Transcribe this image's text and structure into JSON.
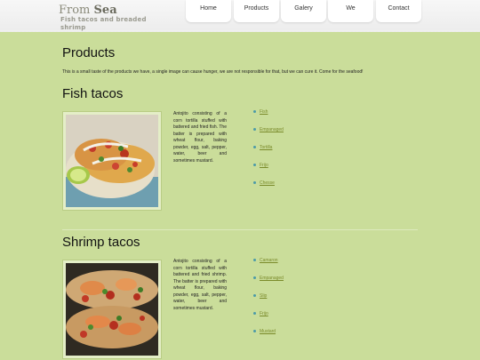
{
  "header": {
    "logo_prefix": "From",
    "logo_name": "Sea",
    "tagline": "Fish tacos and breaded shrimp"
  },
  "nav": [
    {
      "label": "Home"
    },
    {
      "label": "Products"
    },
    {
      "label": "Galery"
    },
    {
      "label": "We"
    },
    {
      "label": "Contact"
    }
  ],
  "page": {
    "title": "Products",
    "intro": "This is a small taste of the products we have, a single image can cause hunger, we are not responsible for that, but we can cure it. Come for the seafood!"
  },
  "products": [
    {
      "name": "Fish tacos",
      "description": "Antojito consisting of a corn tortilla stuffed with battered and fried fish. The batter is prepared with wheat flour, baking powder, egg, salt, pepper, water, beer and sometimes mustard.",
      "ingredients": [
        "Fish",
        "Empanaged",
        "Tortilla",
        "Frijo",
        "Chesse"
      ]
    },
    {
      "name": "Shrimp tacos",
      "description": "Antojito consisting of a corn tortilla stuffed with battered and fried shrimp. The batter is prepared with wheat flour, baking powder, egg, salt, pepper, water, beer and sometimes mustard.",
      "ingredients": [
        "Camaron",
        "Empanaged",
        "Slip",
        "Frijo",
        "Mustard"
      ]
    }
  ],
  "colors": {
    "page_background": "#cadd9a",
    "link": "#7a8a2a",
    "bullet": "#4a9aa8"
  }
}
